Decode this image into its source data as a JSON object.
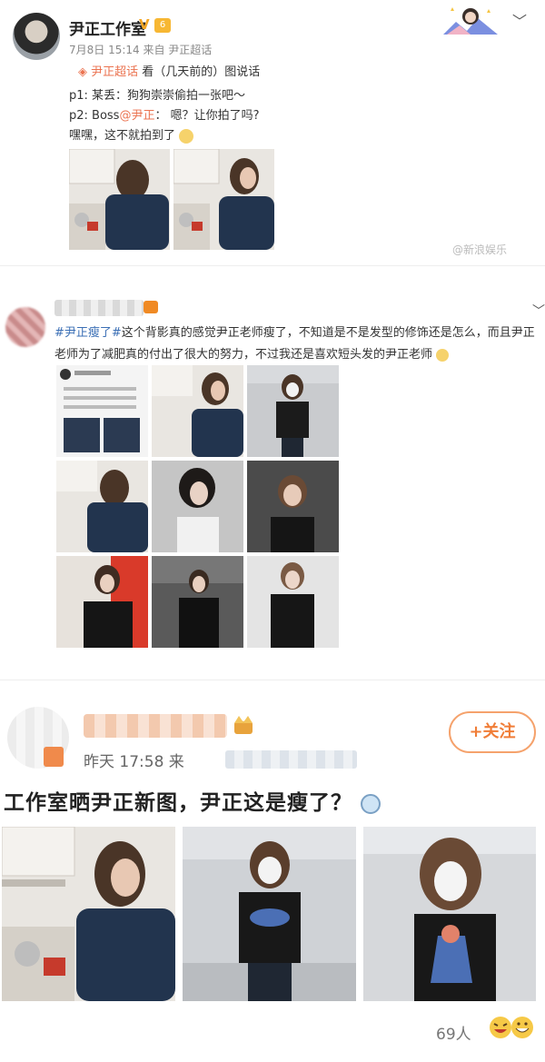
{
  "post1": {
    "author": "尹正工作室",
    "verified_mark": "V",
    "level_badge": "6",
    "meta": "7月8日 15:14 来自 尹正超话",
    "super_topic_tag": "尹正超话",
    "super_topic_rest": " 看（几天前的）图说话",
    "line1": "p1: 某丢：狗狗崇崇偷拍一张吧～",
    "line2_prefix": "p2: Boss",
    "line2_mention": "@尹正",
    "line2_suffix": "： 嗯？让你拍了吗?",
    "line3": "嘿嘿，这不就拍到了",
    "watermark": "@新浪娱乐"
  },
  "post2": {
    "hashtag": "#尹正瘦了#",
    "text": "这个背影真的感觉尹正老师瘦了，不知道是不是发型的修饰还是怎么，而且尹正老师为了减肥真的付出了很大的努力，不过我还是喜欢短头发的尹正老师"
  },
  "post3": {
    "follow_label": "+关注",
    "time": "昨天 17:58  来",
    "title": "工作室晒尹正新图，尹正这是瘦了？",
    "likes": "69人"
  },
  "colors": {
    "accent_orange": "#eb7350",
    "hashtag_blue": "#3b6fb5",
    "follow_orange": "#f07d37"
  }
}
